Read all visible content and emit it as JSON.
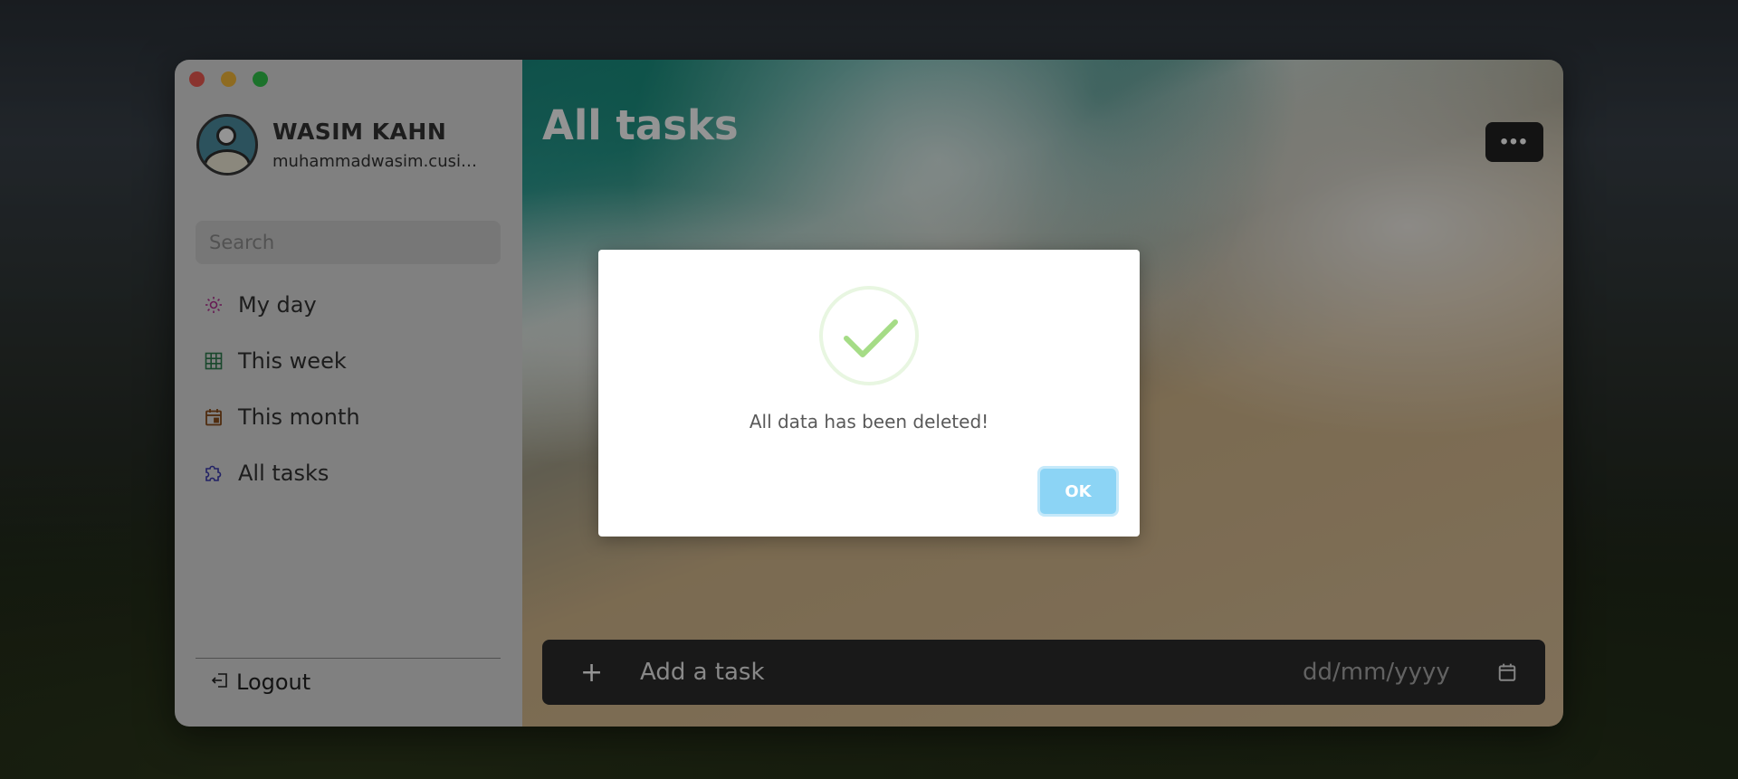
{
  "window": {
    "traffic_lights": [
      "close",
      "minimize",
      "maximize"
    ]
  },
  "profile": {
    "name": "WASIM KAHN",
    "email": "muhammadwasim.cusit..."
  },
  "search": {
    "placeholder": "Search"
  },
  "nav": {
    "items": [
      {
        "label": "My day",
        "icon": "sun-icon",
        "color": "#b0308f"
      },
      {
        "label": "This week",
        "icon": "grid-icon",
        "color": "#2e7d4f"
      },
      {
        "label": "This month",
        "icon": "calendar-icon",
        "color": "#8a4d1a"
      },
      {
        "label": "All tasks",
        "icon": "puzzle-icon",
        "color": "#3b3bb0"
      }
    ]
  },
  "logout": {
    "label": "Logout"
  },
  "main": {
    "title": "All tasks",
    "more_label": "•••"
  },
  "addbar": {
    "plus": "+",
    "placeholder": "Add a task",
    "date_placeholder": "dd/mm/yyyy"
  },
  "modal": {
    "message": "All data has been deleted!",
    "ok_label": "OK",
    "accent": "#a5dc86",
    "button_color": "#8cd4f5"
  }
}
